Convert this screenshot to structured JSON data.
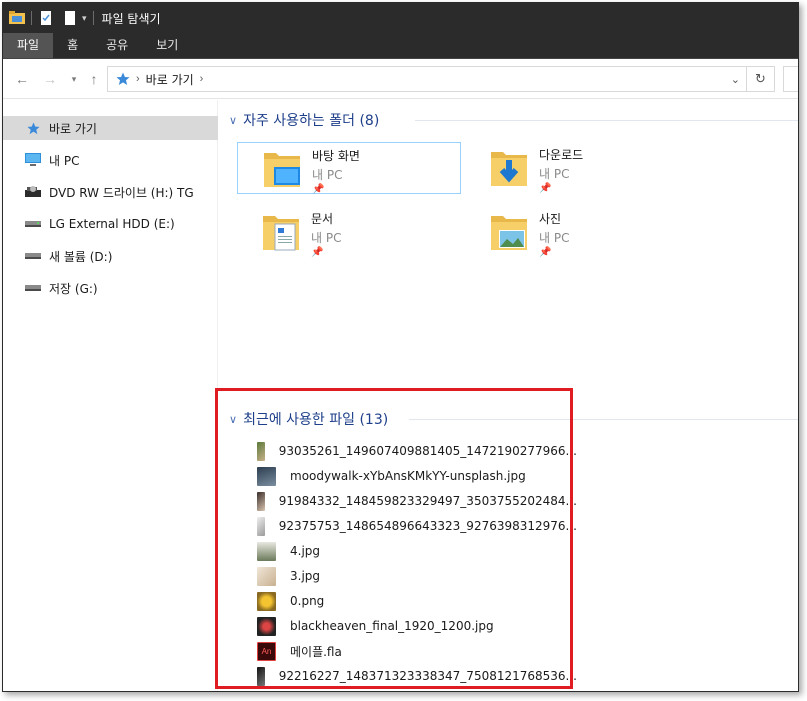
{
  "window": {
    "title": "파일 탐색기"
  },
  "ribbon": {
    "tabs": [
      "파일",
      "홈",
      "공유",
      "보기"
    ]
  },
  "address": {
    "crumb": "바로 가기"
  },
  "sidebar": {
    "items": [
      {
        "label": "바로 가기",
        "icon": "star-icon"
      },
      {
        "label": "내 PC",
        "icon": "computer-icon"
      },
      {
        "label": "DVD RW 드라이브 (H:) TG",
        "icon": "dvd-drive-icon"
      },
      {
        "label": "LG External HDD (E:)",
        "icon": "drive-icon"
      },
      {
        "label": "새 볼륨 (D:)",
        "icon": "drive-icon"
      },
      {
        "label": "저장 (G:)",
        "icon": "drive-icon"
      }
    ]
  },
  "frequent": {
    "header": "자주 사용하는 폴더 (8)",
    "folders": [
      {
        "name": "바탕 화면",
        "location": "내 PC"
      },
      {
        "name": "다운로드",
        "location": "내 PC"
      },
      {
        "name": "문서",
        "location": "내 PC"
      },
      {
        "name": "사진",
        "location": "내 PC"
      }
    ]
  },
  "recent": {
    "header": "최근에 사용한 파일 (13)",
    "files": [
      "93035261_149607409881405_1472190277966...",
      "moodywalk-xYbAnsKMkYY-unsplash.jpg",
      "91984332_148459823329497_3503755202484...",
      "92375753_148654896643323_9276398312976...",
      "4.jpg",
      "3.jpg",
      "0.png",
      "blackheaven_final_1920_1200.jpg",
      "메이플.fla",
      "92216227_148371323338347_7508121768536..."
    ]
  },
  "colors": {
    "accent": "#1e3f8a",
    "highlight": "#e11b22",
    "titlebar": "#2b2b2b"
  }
}
